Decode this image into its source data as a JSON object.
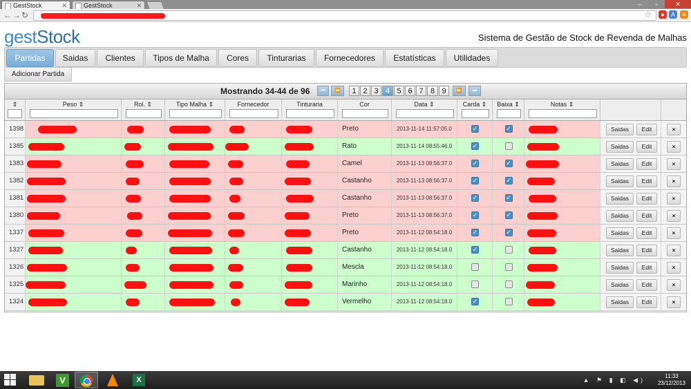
{
  "browser": {
    "tabs": [
      {
        "label": "GestStock",
        "active": true
      },
      {
        "label": "GestStock",
        "active": false
      }
    ]
  },
  "app": {
    "logo_part1": "gest",
    "logo_part2": "Stock",
    "system_name": "Sistema de Gestão de Stock de Revenda de Malhas"
  },
  "nav": {
    "tabs": [
      "Partidas",
      "Saidas",
      "Clientes",
      "Tipos de Malha",
      "Cores",
      "Tinturarias",
      "Fornecedores",
      "Estatísticas",
      "Utilidades"
    ],
    "active": "Partidas"
  },
  "add_button": "Adicionar Partida",
  "pager": {
    "showing": "Mostrando 34-44 de 96",
    "first": "⏮",
    "prev": "⏪",
    "next": "⏩",
    "last": "⏭",
    "pages": [
      "1",
      "2",
      "3",
      "4",
      "5",
      "6",
      "7",
      "8",
      "9"
    ],
    "current_page": "4"
  },
  "columns": [
    "",
    "Peso",
    "Rol.",
    "Tipo Malha",
    "Fornecedor",
    "Tinturaria",
    "Cor",
    "Data",
    "Carda",
    "Baixa",
    "Notas"
  ],
  "sort_icon": "⇕",
  "row_buttons": {
    "saidas": "Saidas",
    "edit": "Edit",
    "delete": "×"
  },
  "rows": [
    {
      "id": "1398",
      "cor": "Preto",
      "data": "2013-11-14 11:57:05.0",
      "carda": true,
      "baixa": true,
      "status": "pink"
    },
    {
      "id": "1385",
      "cor": "Rato",
      "data": "2013-11-14 08:55:46.0",
      "carda": true,
      "baixa": false,
      "status": "green"
    },
    {
      "id": "1383",
      "cor": "Camel",
      "data": "2013-11-13 08:56:37.0",
      "carda": true,
      "baixa": true,
      "status": "pink"
    },
    {
      "id": "1382",
      "cor": "Castanho",
      "data": "2013-11-13 08:56:37.0",
      "carda": true,
      "baixa": true,
      "status": "pink"
    },
    {
      "id": "1381",
      "cor": "Castanho",
      "data": "2013-11-13 08:56:37.0",
      "carda": true,
      "baixa": true,
      "status": "pink"
    },
    {
      "id": "1380",
      "cor": "Preto",
      "data": "2013-11-13 08:56:37.0",
      "carda": true,
      "baixa": true,
      "status": "pink"
    },
    {
      "id": "1337",
      "cor": "Preto",
      "data": "2013-11-12 08:54:18.0",
      "carda": true,
      "baixa": true,
      "status": "pink"
    },
    {
      "id": "1327",
      "cor": "Castanho",
      "data": "2013-11-12 08:54:18.0",
      "carda": true,
      "baixa": false,
      "status": "green"
    },
    {
      "id": "1326",
      "cor": "Mescla",
      "data": "2013-11-12 08:54:18.0",
      "carda": false,
      "baixa": false,
      "status": "green"
    },
    {
      "id": "1325",
      "cor": "Marinho",
      "data": "2013-11-12 08:54:18.0",
      "carda": false,
      "baixa": false,
      "status": "green"
    },
    {
      "id": "1324",
      "cor": "Vermelho",
      "data": "2013-11-12 08:54:18.0",
      "carda": true,
      "baixa": false,
      "status": "green"
    }
  ],
  "taskbar": {
    "time": "11:33",
    "date": "23/12/2013"
  },
  "colors": {
    "accent": "#3d89c9",
    "row_pink": "#fdd0d0",
    "row_green": "#ccffcc",
    "redaction": "#ff1010"
  }
}
